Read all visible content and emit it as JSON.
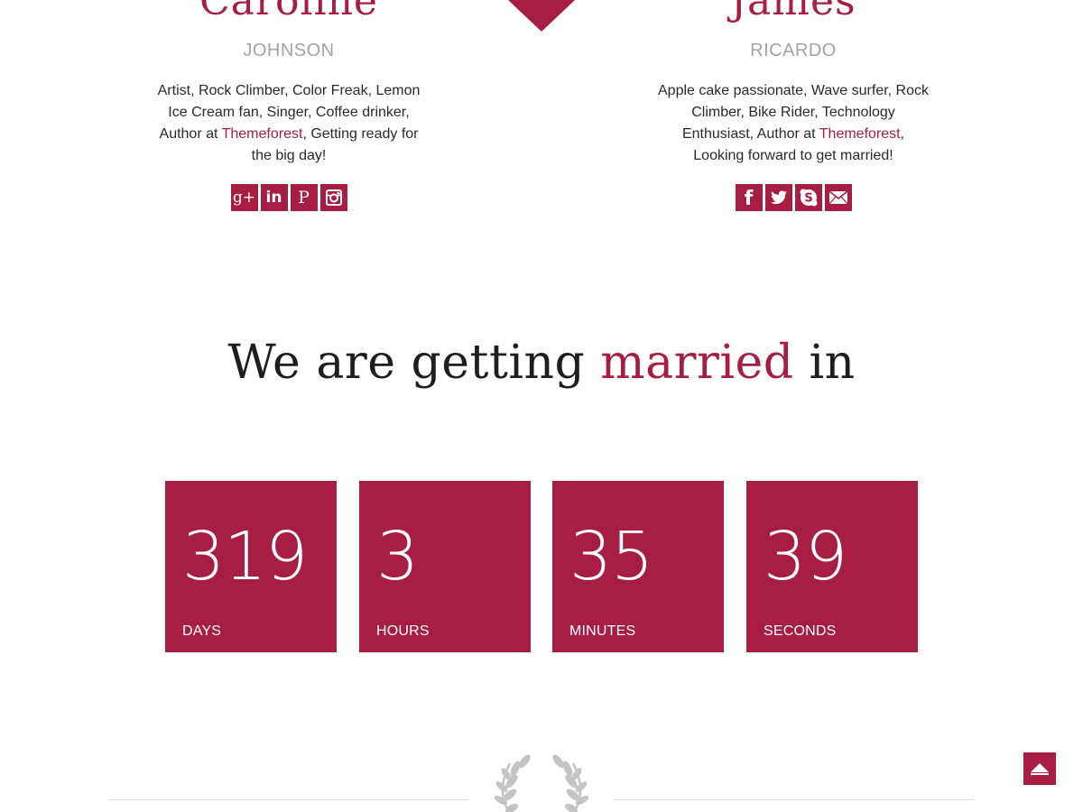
{
  "bride": {
    "first_name": "Caroline",
    "last_name": "JOHNSON",
    "bio_before_link": "Artist, Rock Climber, Color Freak, Lemon Ice Cream fan, Singer, Coffee drinker, Author at ",
    "bio_link": "Themeforest",
    "bio_after_link": ", Getting ready for the big day!",
    "social": [
      {
        "icon": "google-plus-icon",
        "glyph": "g+"
      },
      {
        "icon": "linkedin-icon",
        "glyph": "in"
      },
      {
        "icon": "pinterest-icon",
        "glyph": "P"
      },
      {
        "icon": "instagram-icon",
        "glyph": ""
      }
    ]
  },
  "groom": {
    "first_name": "James",
    "last_name": "RICARDO",
    "bio_before_link": "Apple cake passionate, Wave surfer, Rock Climber, Bike Rider, Technology Enthusiast, Author at ",
    "bio_link": "Themeforest",
    "bio_after_link": ", Looking forward to get married!",
    "social": [
      {
        "icon": "facebook-icon",
        "glyph": "f"
      },
      {
        "icon": "twitter-icon",
        "glyph": ""
      },
      {
        "icon": "skype-icon",
        "glyph": "S"
      },
      {
        "icon": "email-icon",
        "glyph": ""
      }
    ]
  },
  "headline": {
    "part1": "We are getting ",
    "accent": "married",
    "part2": " in"
  },
  "countdown": [
    {
      "value": "319",
      "label": "DAYS"
    },
    {
      "value": "3",
      "label": "HOURS"
    },
    {
      "value": "35",
      "label": "MINUTES"
    },
    {
      "value": "39",
      "label": "SECONDS"
    }
  ],
  "colors": {
    "accent": "#a81d44",
    "muted_text": "#a3a3a3",
    "body_text": "#2a2a2a",
    "divider": "#dcdcdc",
    "laurel": "#c4c4c4"
  },
  "icons": {
    "heart": "heart-icon",
    "laurel": "laurel-wreath-icon",
    "back_to_top": "chevron-up-icon"
  }
}
